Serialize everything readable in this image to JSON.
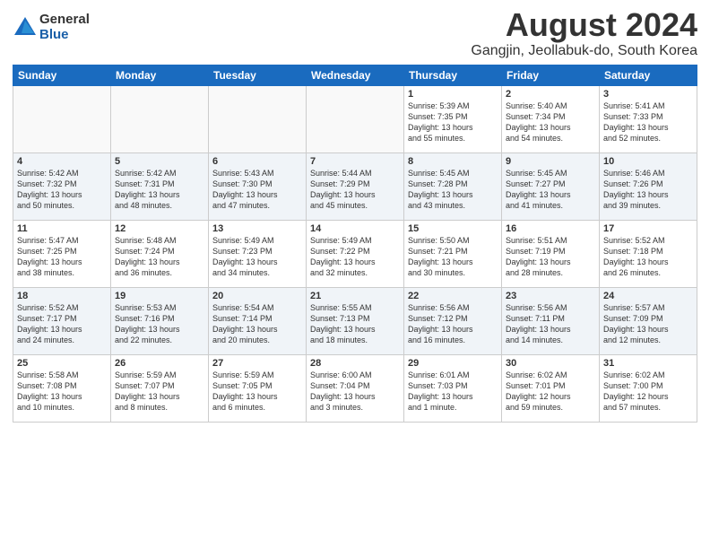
{
  "header": {
    "logo_general": "General",
    "logo_blue": "Blue",
    "title": "August 2024",
    "subtitle": "Gangjin, Jeollabuk-do, South Korea"
  },
  "days_of_week": [
    "Sunday",
    "Monday",
    "Tuesday",
    "Wednesday",
    "Thursday",
    "Friday",
    "Saturday"
  ],
  "weeks": [
    [
      {
        "num": "",
        "info": ""
      },
      {
        "num": "",
        "info": ""
      },
      {
        "num": "",
        "info": ""
      },
      {
        "num": "",
        "info": ""
      },
      {
        "num": "1",
        "info": "Sunrise: 5:39 AM\nSunset: 7:35 PM\nDaylight: 13 hours\nand 55 minutes."
      },
      {
        "num": "2",
        "info": "Sunrise: 5:40 AM\nSunset: 7:34 PM\nDaylight: 13 hours\nand 54 minutes."
      },
      {
        "num": "3",
        "info": "Sunrise: 5:41 AM\nSunset: 7:33 PM\nDaylight: 13 hours\nand 52 minutes."
      }
    ],
    [
      {
        "num": "4",
        "info": "Sunrise: 5:42 AM\nSunset: 7:32 PM\nDaylight: 13 hours\nand 50 minutes."
      },
      {
        "num": "5",
        "info": "Sunrise: 5:42 AM\nSunset: 7:31 PM\nDaylight: 13 hours\nand 48 minutes."
      },
      {
        "num": "6",
        "info": "Sunrise: 5:43 AM\nSunset: 7:30 PM\nDaylight: 13 hours\nand 47 minutes."
      },
      {
        "num": "7",
        "info": "Sunrise: 5:44 AM\nSunset: 7:29 PM\nDaylight: 13 hours\nand 45 minutes."
      },
      {
        "num": "8",
        "info": "Sunrise: 5:45 AM\nSunset: 7:28 PM\nDaylight: 13 hours\nand 43 minutes."
      },
      {
        "num": "9",
        "info": "Sunrise: 5:45 AM\nSunset: 7:27 PM\nDaylight: 13 hours\nand 41 minutes."
      },
      {
        "num": "10",
        "info": "Sunrise: 5:46 AM\nSunset: 7:26 PM\nDaylight: 13 hours\nand 39 minutes."
      }
    ],
    [
      {
        "num": "11",
        "info": "Sunrise: 5:47 AM\nSunset: 7:25 PM\nDaylight: 13 hours\nand 38 minutes."
      },
      {
        "num": "12",
        "info": "Sunrise: 5:48 AM\nSunset: 7:24 PM\nDaylight: 13 hours\nand 36 minutes."
      },
      {
        "num": "13",
        "info": "Sunrise: 5:49 AM\nSunset: 7:23 PM\nDaylight: 13 hours\nand 34 minutes."
      },
      {
        "num": "14",
        "info": "Sunrise: 5:49 AM\nSunset: 7:22 PM\nDaylight: 13 hours\nand 32 minutes."
      },
      {
        "num": "15",
        "info": "Sunrise: 5:50 AM\nSunset: 7:21 PM\nDaylight: 13 hours\nand 30 minutes."
      },
      {
        "num": "16",
        "info": "Sunrise: 5:51 AM\nSunset: 7:19 PM\nDaylight: 13 hours\nand 28 minutes."
      },
      {
        "num": "17",
        "info": "Sunrise: 5:52 AM\nSunset: 7:18 PM\nDaylight: 13 hours\nand 26 minutes."
      }
    ],
    [
      {
        "num": "18",
        "info": "Sunrise: 5:52 AM\nSunset: 7:17 PM\nDaylight: 13 hours\nand 24 minutes."
      },
      {
        "num": "19",
        "info": "Sunrise: 5:53 AM\nSunset: 7:16 PM\nDaylight: 13 hours\nand 22 minutes."
      },
      {
        "num": "20",
        "info": "Sunrise: 5:54 AM\nSunset: 7:14 PM\nDaylight: 13 hours\nand 20 minutes."
      },
      {
        "num": "21",
        "info": "Sunrise: 5:55 AM\nSunset: 7:13 PM\nDaylight: 13 hours\nand 18 minutes."
      },
      {
        "num": "22",
        "info": "Sunrise: 5:56 AM\nSunset: 7:12 PM\nDaylight: 13 hours\nand 16 minutes."
      },
      {
        "num": "23",
        "info": "Sunrise: 5:56 AM\nSunset: 7:11 PM\nDaylight: 13 hours\nand 14 minutes."
      },
      {
        "num": "24",
        "info": "Sunrise: 5:57 AM\nSunset: 7:09 PM\nDaylight: 13 hours\nand 12 minutes."
      }
    ],
    [
      {
        "num": "25",
        "info": "Sunrise: 5:58 AM\nSunset: 7:08 PM\nDaylight: 13 hours\nand 10 minutes."
      },
      {
        "num": "26",
        "info": "Sunrise: 5:59 AM\nSunset: 7:07 PM\nDaylight: 13 hours\nand 8 minutes."
      },
      {
        "num": "27",
        "info": "Sunrise: 5:59 AM\nSunset: 7:05 PM\nDaylight: 13 hours\nand 6 minutes."
      },
      {
        "num": "28",
        "info": "Sunrise: 6:00 AM\nSunset: 7:04 PM\nDaylight: 13 hours\nand 3 minutes."
      },
      {
        "num": "29",
        "info": "Sunrise: 6:01 AM\nSunset: 7:03 PM\nDaylight: 13 hours\nand 1 minute."
      },
      {
        "num": "30",
        "info": "Sunrise: 6:02 AM\nSunset: 7:01 PM\nDaylight: 12 hours\nand 59 minutes."
      },
      {
        "num": "31",
        "info": "Sunrise: 6:02 AM\nSunset: 7:00 PM\nDaylight: 12 hours\nand 57 minutes."
      }
    ]
  ]
}
